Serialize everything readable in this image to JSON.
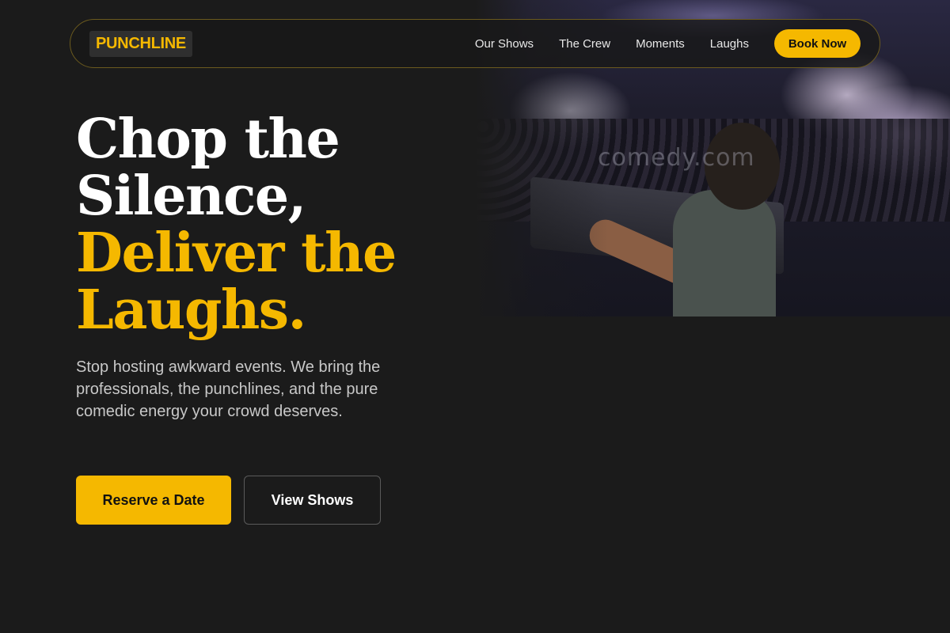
{
  "brand": {
    "logo_text": "PUNCHLINE"
  },
  "nav": {
    "links": [
      "Our Shows",
      "The Crew",
      "Moments",
      "Laughs"
    ],
    "cta_label": "Book Now"
  },
  "hero": {
    "headline_lines": [
      "Chop the",
      "Silence,",
      "Deliver the",
      "Laughs."
    ],
    "subtext": "Stop hosting awkward events. We bring the professionals, the punchlines, and the pure comedic energy your crowd deserves.",
    "primary_button": "Reserve a Date",
    "secondary_button": "View Shows",
    "image_watermark": "comedy.com"
  },
  "colors": {
    "accent": "#f5b800",
    "background": "#1b1b1b",
    "text": "#ffffff"
  }
}
